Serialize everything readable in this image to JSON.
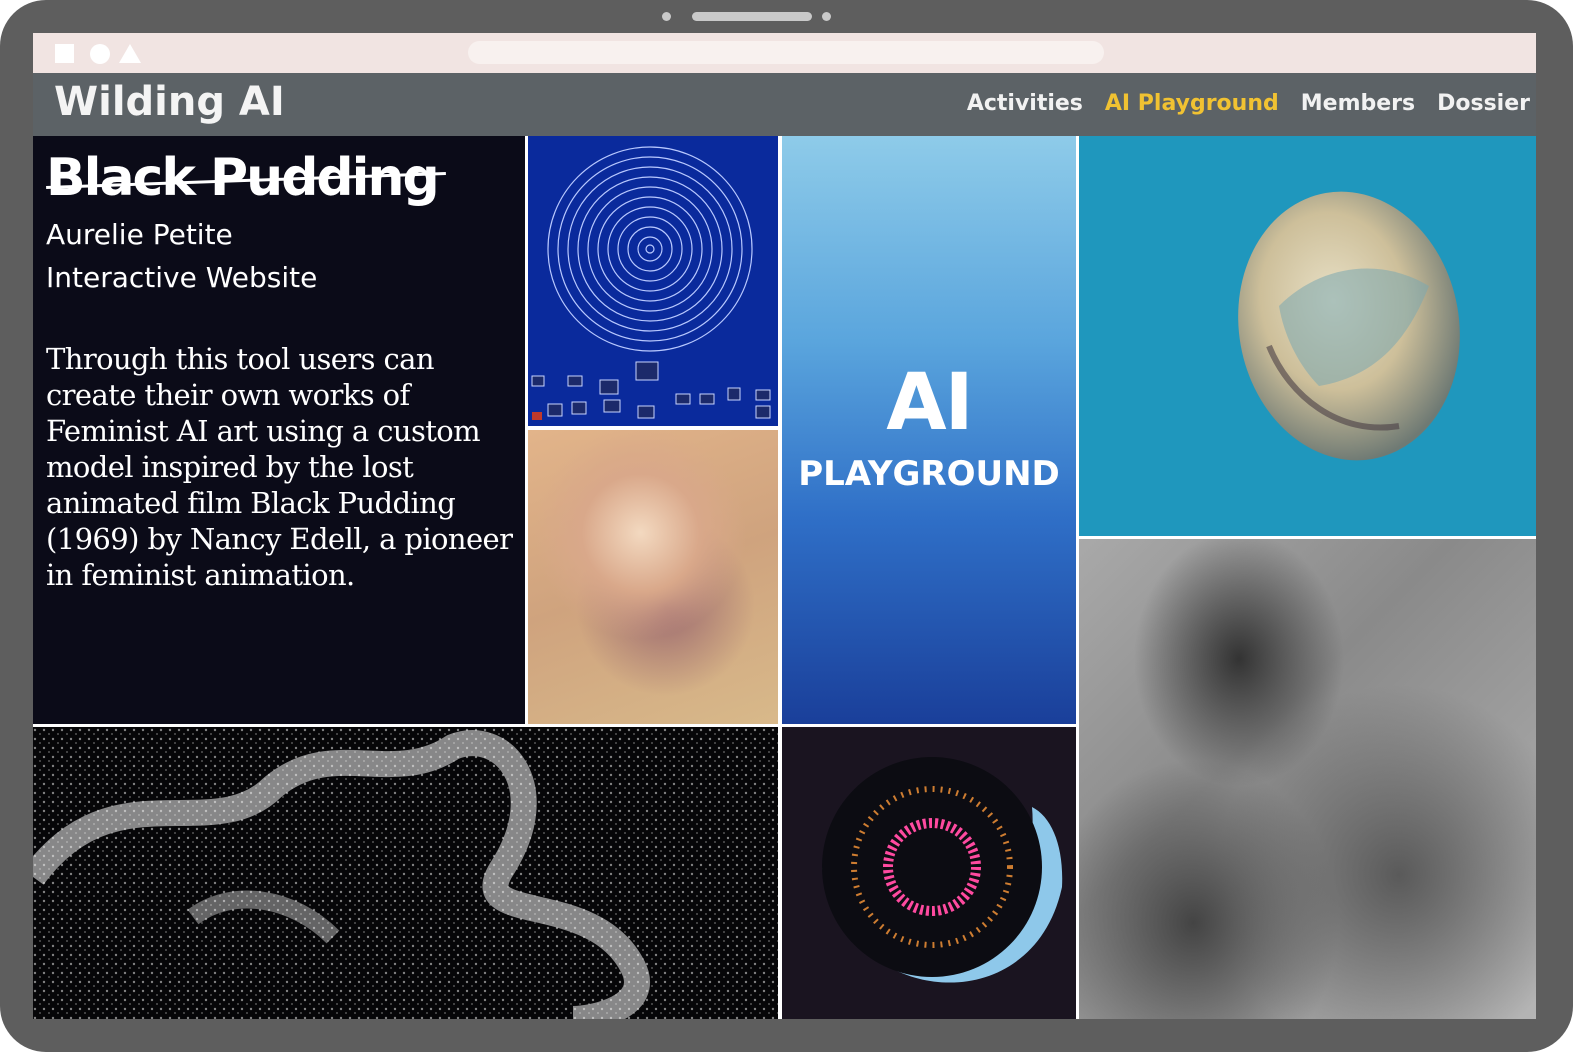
{
  "site": {
    "brand": "Wilding AI",
    "nav": [
      {
        "label": "Activities",
        "active": false
      },
      {
        "label": "AI Playground",
        "active": true
      },
      {
        "label": "Members",
        "active": false
      },
      {
        "label": "Dossier",
        "active": false
      }
    ]
  },
  "project": {
    "title": "Black Pudding",
    "author": "Aurelie Petite",
    "type": "Interactive Website",
    "description": "Through this tool users can create their own works of Feminist AI art using a custom model inspired by the lost animated film Black Pudding (1969) by Nancy Edell, a pioneer in feminist animation."
  },
  "playground_tile": {
    "line1": "AI",
    "line2": "PLAYGROUND"
  },
  "colors": {
    "nav_bar": "#5c6266",
    "nav_active": "#f1c232",
    "info_panel": "#0b0b18",
    "device_frame": "#5e5e5e"
  }
}
